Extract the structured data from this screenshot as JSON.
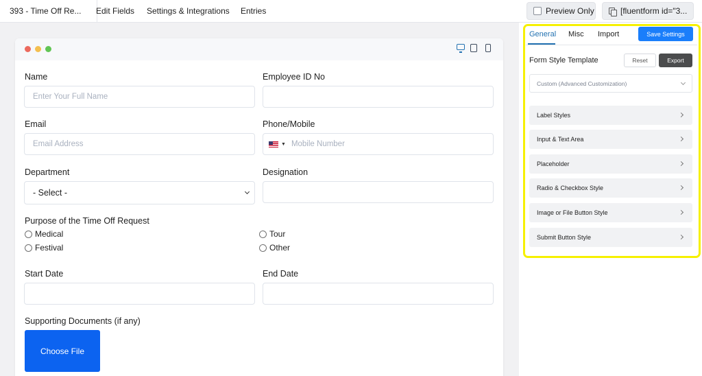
{
  "topbar": {
    "form_title": "393 - Time Off Re...",
    "nav": [
      "Edit Fields",
      "Settings & Integrations",
      "Entries"
    ],
    "preview_label": "Preview Only",
    "shortcode": "[fluentform id=\"3..."
  },
  "form": {
    "name_label": "Name",
    "name_placeholder": "Enter Your Full Name",
    "employee_id_label": "Employee ID No",
    "email_label": "Email",
    "email_placeholder": "Email Address",
    "phone_label": "Phone/Mobile",
    "phone_placeholder": "Mobile Number",
    "department_label": "Department",
    "department_value": "- Select -",
    "designation_label": "Designation",
    "purpose_label": "Purpose of the Time Off Request",
    "purpose_options": [
      "Medical",
      "Tour",
      "Festival",
      "Other"
    ],
    "start_date_label": "Start Date",
    "end_date_label": "End Date",
    "documents_label": "Supporting Documents (if any)",
    "choose_file_label": "Choose File"
  },
  "panel": {
    "tabs": [
      "General",
      "Misc",
      "Import"
    ],
    "active_tab": "General",
    "save_label": "Save Settings",
    "style_template_label": "Form Style Template",
    "reset_label": "Reset",
    "export_label": "Export",
    "template_value": "Custom (Advanced Customization)",
    "sections": [
      "Label Styles",
      "Input & Text Area",
      "Placeholder",
      "Radio & Checkbox Style",
      "Image or File Button Style",
      "Submit Button Style"
    ]
  },
  "colors": {
    "accent": "#1a7efb",
    "active_tab": "#2271b1",
    "highlight": "#f6f000",
    "file_button": "#0c63f0",
    "dot_red": "#ec6a5e",
    "dot_yellow": "#f4bf4f",
    "dot_green": "#61c554"
  }
}
